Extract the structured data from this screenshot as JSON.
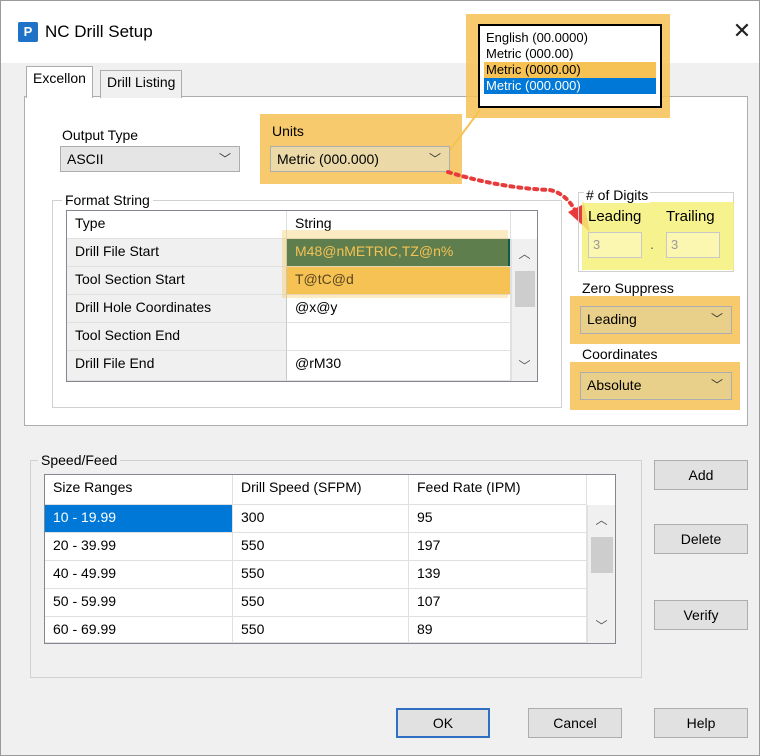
{
  "window": {
    "title": "NC Drill Setup",
    "close_glyph": "✕"
  },
  "tabs": [
    {
      "label": "Excellon"
    },
    {
      "label": "Drill Listing"
    }
  ],
  "output_type": {
    "label": "Output Type",
    "value": "ASCII"
  },
  "units": {
    "label": "Units",
    "value": "Metric (000.000)",
    "options": [
      "English (00.0000)",
      "Metric (000.00)",
      "Metric (0000.00)",
      "Metric (000.000)"
    ]
  },
  "format_string": {
    "label": "Format String",
    "columns": [
      "Type",
      "String"
    ],
    "rows": [
      {
        "type": "Drill File Start",
        "string": "M48@nMETRIC,TZ@n%"
      },
      {
        "type": "Tool Section Start",
        "string": "T@tC@d"
      },
      {
        "type": "Drill Hole Coordinates",
        "string": "@x@y"
      },
      {
        "type": "Tool Section End",
        "string": ""
      },
      {
        "type": "Drill File End",
        "string": "@rM30"
      }
    ]
  },
  "digits": {
    "label": "# of Digits",
    "leading_label": "Leading",
    "trailing_label": "Trailing",
    "leading_value": "3",
    "separator": ".",
    "trailing_value": "3"
  },
  "zero_suppress": {
    "label": "Zero Suppress",
    "value": "Leading"
  },
  "coordinates": {
    "label": "Coordinates",
    "value": "Absolute"
  },
  "speed_feed": {
    "label": "Speed/Feed",
    "columns": [
      "Size Ranges",
      "Drill Speed (SFPM)",
      "Feed Rate (IPM)"
    ],
    "rows": [
      {
        "range": "10 - 19.99",
        "speed": "300",
        "feed": "95"
      },
      {
        "range": "20 - 39.99",
        "speed": "550",
        "feed": "197"
      },
      {
        "range": "40 - 49.99",
        "speed": "550",
        "feed": "139"
      },
      {
        "range": "50 - 59.99",
        "speed": "550",
        "feed": "107"
      },
      {
        "range": "60 - 69.99",
        "speed": "550",
        "feed": "89"
      }
    ]
  },
  "side_buttons": {
    "add": "Add",
    "delete": "Delete",
    "verify": "Verify"
  },
  "footer_buttons": {
    "ok": "OK",
    "cancel": "Cancel",
    "help": "Help"
  },
  "colors": {
    "highlight": "#f6c254",
    "selection": "#0078d7",
    "selected_cell": "#0f5a4a",
    "selected_cell_text": "#f6c254",
    "arrow": "#e83a3a"
  },
  "icons": {
    "app": "app-icon",
    "dropdown": "chevron-down-icon",
    "scroll_up": "chevron-up-icon",
    "scroll_down": "chevron-down-icon"
  }
}
